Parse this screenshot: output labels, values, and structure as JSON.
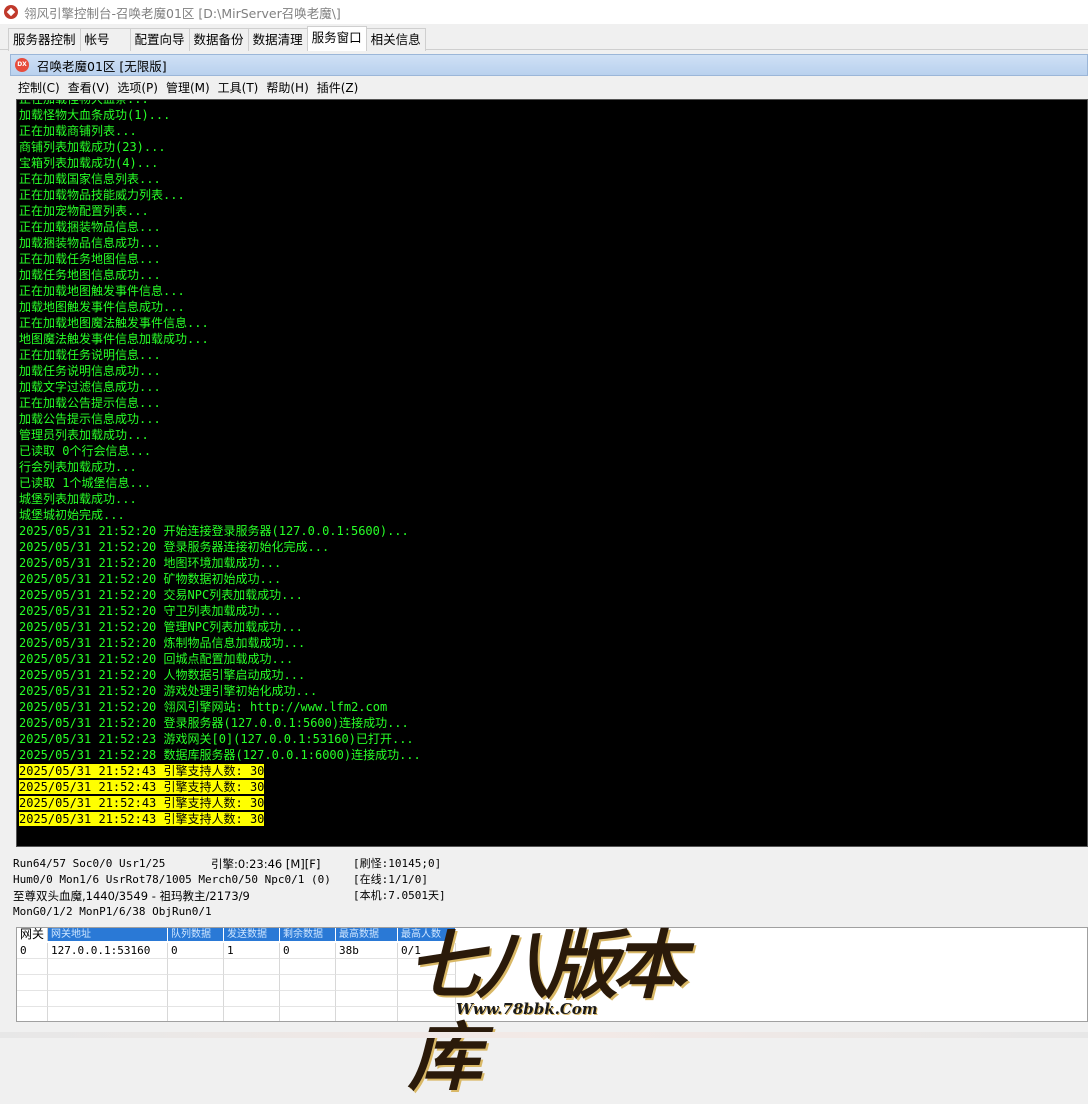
{
  "window": {
    "title": "翎风引擎控制台-召唤老魔01区 [D:\\MirServer召唤老魔\\]"
  },
  "tabs": [
    {
      "label": "服务器控制",
      "active": false
    },
    {
      "label": "帐号",
      "active": false
    },
    {
      "label": "配置向导",
      "active": false
    },
    {
      "label": "数据备份",
      "active": false
    },
    {
      "label": "数据清理",
      "active": false
    },
    {
      "label": "服务窗口",
      "active": true
    },
    {
      "label": "相关信息",
      "active": false
    }
  ],
  "subwindow": {
    "icon_text": "DX",
    "title": "召唤老魔01区 [无限版]"
  },
  "menu": [
    "控制(C)",
    "查看(V)",
    "选项(P)",
    "管理(M)",
    "工具(T)",
    "帮助(H)",
    "插件(Z)"
  ],
  "console": {
    "lines": [
      "正在加载怪物大血条...",
      "加载怪物大血条成功(1)...",
      "正在加载商铺列表...",
      "商铺列表加载成功(23)...",
      "宝箱列表加载成功(4)...",
      "正在加载国家信息列表...",
      "正在加载物品技能威力列表...",
      "正在加宠物配置列表...",
      "正在加载捆装物品信息...",
      "加载捆装物品信息成功...",
      "正在加载任务地图信息...",
      "加载任务地图信息成功...",
      "正在加载地图触发事件信息...",
      "加载地图触发事件信息成功...",
      "正在加载地图魔法触发事件信息...",
      "地图魔法触发事件信息加载成功...",
      "正在加载任务说明信息...",
      "加载任务说明信息成功...",
      "加载文字过滤信息成功...",
      "正在加载公告提示信息...",
      "加载公告提示信息成功...",
      "管理员列表加载成功...",
      "已读取 0个行会信息...",
      "行会列表加载成功...",
      "已读取 1个城堡信息...",
      "城堡列表加载成功...",
      "城堡城初始完成...",
      "2025/05/31 21:52:20 开始连接登录服务器(127.0.0.1:5600)...",
      "2025/05/31 21:52:20 登录服务器连接初始化完成...",
      "2025/05/31 21:52:20 地图环境加载成功...",
      "2025/05/31 21:52:20 矿物数据初始成功...",
      "2025/05/31 21:52:20 交易NPC列表加载成功...",
      "2025/05/31 21:52:20 守卫列表加载成功...",
      "2025/05/31 21:52:20 管理NPC列表加载成功...",
      "2025/05/31 21:52:20 炼制物品信息加载成功...",
      "2025/05/31 21:52:20 回城点配置加载成功...",
      "2025/05/31 21:52:20 人物数据引擎启动成功...",
      "2025/05/31 21:52:20 游戏处理引擎初始化成功...",
      "2025/05/31 21:52:20 翎风引擎网站: http://www.lfm2.com",
      "2025/05/31 21:52:20 登录服务器(127.0.0.1:5600)连接成功...",
      "2025/05/31 21:52:23 游戏网关[0](127.0.0.1:53160)已打开...",
      "2025/05/31 21:52:28 数据库服务器(127.0.0.1:6000)连接成功..."
    ],
    "highlight_lines": [
      "2025/05/31 21:52:43 引擎支持人数: 30",
      "2025/05/31 21:52:43 引擎支持人数: 30",
      "2025/05/31 21:52:43 引擎支持人数: 30",
      "2025/05/31 21:52:43 引擎支持人数: 30"
    ]
  },
  "status": {
    "row1": {
      "a": "Run64/57 Soc0/0 Usr1/25",
      "b": "引擎:0:23:46 [M][F]",
      "c": "[刷怪:10145;0]"
    },
    "row2": {
      "a": "Hum0/0 Mon1/6 UsrRot78/1005 Merch0/50 Npc0/1 (0)",
      "c": "[在线:1/1/0]"
    },
    "row3": {
      "a": "至尊双头血魔,1440/3549 - 祖玛教主/2173/9",
      "c": "[本机:7.0501天]"
    },
    "row4": {
      "a": "MonG0/1/2 MonP1/6/38 ObjRun0/1"
    }
  },
  "gateway_grid": {
    "headers": [
      "网关",
      "网关地址",
      "队列数据",
      "发送数据",
      "剩余数据",
      "最高数据",
      "最高人数"
    ],
    "rows": [
      [
        "0",
        "127.0.0.1:53160",
        "0",
        "1",
        "0",
        "38b",
        "0/1"
      ]
    ]
  },
  "watermark": {
    "logo": "七八版本库",
    "url": "Www.78bbk.Com"
  }
}
